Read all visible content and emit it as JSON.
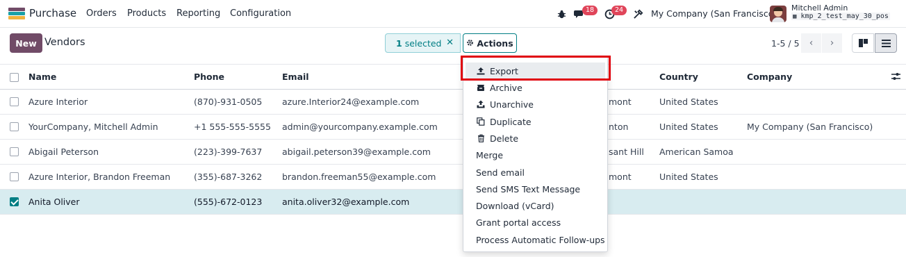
{
  "navbar": {
    "app_name": "Purchase",
    "menu": [
      "Orders",
      "Products",
      "Reporting",
      "Configuration"
    ],
    "messages_count": "18",
    "activities_count": "24",
    "company": "My Company (San Francisco)",
    "user_name": "Mitchell Admin",
    "database": "kmp_2_test_may_30_pos"
  },
  "control_panel": {
    "new_label": "New",
    "title": "Vendors",
    "selected_count": "1",
    "selected_label": "selected",
    "actions_label": "Actions",
    "pager": "1-5 / 5"
  },
  "table": {
    "headers": [
      "Name",
      "Phone",
      "Email",
      "Country",
      "Company"
    ],
    "rows": [
      {
        "name": "Azure Interior",
        "phone": "(870)-931-0505",
        "email": "azure.Interior24@example.com",
        "city": "mont",
        "country": "United States",
        "company": "",
        "checked": false
      },
      {
        "name": "YourCompany, Mitchell Admin",
        "phone": "+1 555-555-5555",
        "email": "admin@yourcompany.example.com",
        "city": "nton",
        "country": "United States",
        "company": "My Company (San Francisco)",
        "checked": false
      },
      {
        "name": "Abigail Peterson",
        "phone": "(223)-399-7637",
        "email": "abigail.peterson39@example.com",
        "city": "sant Hill",
        "country": "American Samoa",
        "company": "",
        "checked": false
      },
      {
        "name": "Azure Interior, Brandon Freeman",
        "phone": "(355)-687-3262",
        "email": "brandon.freeman55@example.com",
        "city": "mont",
        "country": "United States",
        "company": "",
        "checked": false
      },
      {
        "name": "Anita Oliver",
        "phone": "(555)-672-0123",
        "email": "anita.oliver32@example.com",
        "city": "",
        "country": "",
        "company": "",
        "checked": true
      }
    ]
  },
  "actions_menu": {
    "items": [
      {
        "label": "Export",
        "icon": "upload-icon"
      },
      {
        "label": "Archive",
        "icon": "archive-icon"
      },
      {
        "label": "Unarchive",
        "icon": "unarchive-icon"
      },
      {
        "label": "Duplicate",
        "icon": "copy-icon"
      },
      {
        "label": "Delete",
        "icon": "trash-icon"
      },
      {
        "label": "Merge",
        "icon": ""
      },
      {
        "label": "Send email",
        "icon": ""
      },
      {
        "label": "Send SMS Text Message",
        "icon": ""
      },
      {
        "label": "Download (vCard)",
        "icon": ""
      },
      {
        "label": "Grant portal access",
        "icon": ""
      },
      {
        "label": "Process Automatic Follow-ups",
        "icon": ""
      }
    ],
    "highlighted": "Export"
  },
  "colors": {
    "brand": "#714b67",
    "accent": "#017e84",
    "badge": "#e0455a",
    "annotation": "#e0000b"
  }
}
